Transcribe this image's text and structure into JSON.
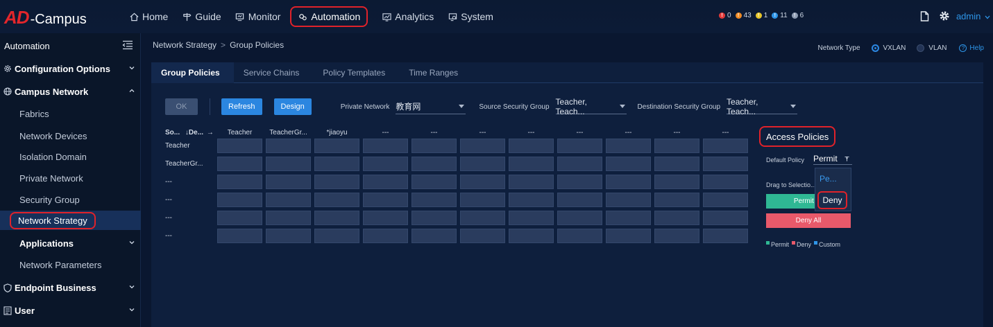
{
  "app": {
    "logo_ad": "AD",
    "logo_campus": "-Campus"
  },
  "nav": {
    "items": [
      {
        "label": "Home",
        "icon": "home-icon"
      },
      {
        "label": "Guide",
        "icon": "signpost-icon"
      },
      {
        "label": "Monitor",
        "icon": "monitor-icon"
      },
      {
        "label": "Automation",
        "icon": "automation-icon"
      },
      {
        "label": "Analytics",
        "icon": "analytics-icon"
      },
      {
        "label": "System",
        "icon": "system-icon"
      }
    ],
    "active": "Automation"
  },
  "alerts": [
    {
      "count": "0",
      "color": "#e23a3a"
    },
    {
      "count": "43",
      "color": "#f08a24"
    },
    {
      "count": "1",
      "color": "#e8c62a"
    },
    {
      "count": "11",
      "color": "#2e95e8"
    },
    {
      "count": "6",
      "color": "#8e9cb3"
    }
  ],
  "header_right": {
    "user": "admin"
  },
  "sidebar": {
    "title": "Automation",
    "items": [
      {
        "label": "Configuration Options",
        "level": "top"
      },
      {
        "label": "Campus Network",
        "level": "top"
      },
      {
        "label": "Fabrics",
        "level": "sub"
      },
      {
        "label": "Network Devices",
        "level": "sub"
      },
      {
        "label": "Isolation Domain",
        "level": "sub"
      },
      {
        "label": "Private Network",
        "level": "sub"
      },
      {
        "label": "Security Group",
        "level": "sub"
      },
      {
        "label": "Network Strategy",
        "level": "sub",
        "selected": true
      },
      {
        "label": "Applications",
        "level": "sub-bold"
      },
      {
        "label": "Network Parameters",
        "level": "sub"
      },
      {
        "label": "Endpoint Business",
        "level": "top"
      },
      {
        "label": "User",
        "level": "top"
      }
    ]
  },
  "breadcrumb": {
    "parent": "Network Strategy",
    "sep": ">",
    "current": "Group Policies"
  },
  "network_type": {
    "label": "Network Type",
    "options": [
      "VXLAN",
      "VLAN"
    ],
    "selected": "VXLAN",
    "help": "Help"
  },
  "tabs": [
    "Group Policies",
    "Service Chains",
    "Policy Templates",
    "Time Ranges"
  ],
  "toolbar": {
    "ok": "OK",
    "refresh": "Refresh",
    "design": "Design",
    "private_network_label": "Private Network",
    "private_network_value": "教育网",
    "source_group_label": "Source Security Group",
    "source_group_value": "Teacher, Teach...",
    "dest_group_label": "Destination Security Group",
    "dest_group_value": "Teacher, Teach..."
  },
  "matrix": {
    "corner_source": "So...",
    "corner_dest": "De...",
    "columns": [
      "Teacher",
      "TeacherGr...",
      "*jiaoyu",
      "---",
      "---",
      "---",
      "---",
      "---",
      "---",
      "---",
      "---"
    ],
    "rows": [
      "Teacher",
      "TeacherGr...",
      "---",
      "---",
      "---",
      "---"
    ]
  },
  "access_policies": {
    "title": "Access Policies",
    "default_policy_label": "Default Policy",
    "default_policy_value": "Permit",
    "dropdown_options": [
      "Pe...",
      "Deny"
    ],
    "drag_label": "Drag to Selectio...",
    "permit_all": "Permit All",
    "deny_all": "Deny All",
    "legend": [
      {
        "label": "Permit",
        "color": "#2fb894"
      },
      {
        "label": "Deny",
        "color": "#e8596a"
      },
      {
        "label": "Custom",
        "color": "#2e95e8"
      }
    ]
  }
}
